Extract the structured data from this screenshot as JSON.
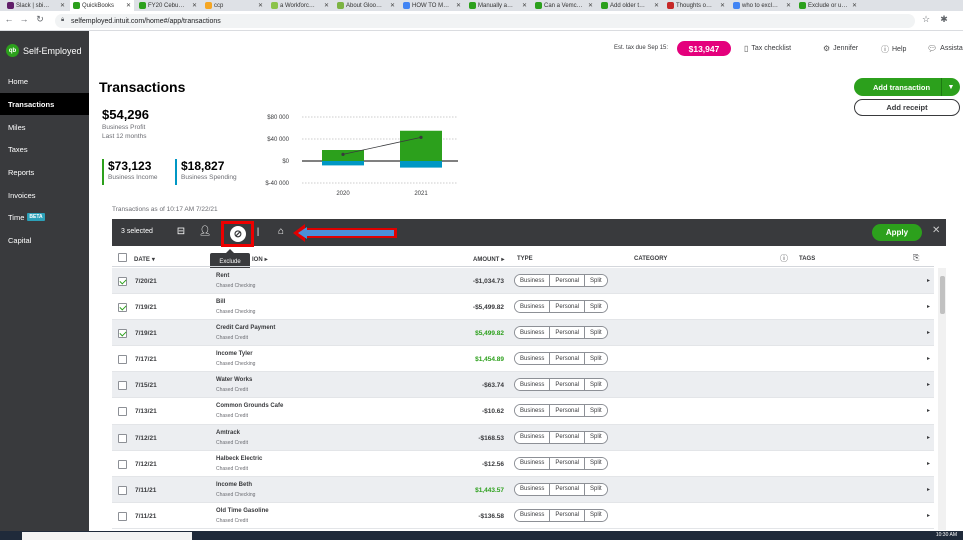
{
  "browser": {
    "tabs": [
      {
        "label": "Slack | sbi…",
        "color": "#611f69"
      },
      {
        "label": "QuickBooks",
        "color": "#2ca01c",
        "active": true
      },
      {
        "label": "FY20 Cebu…",
        "color": "#2ca01c"
      },
      {
        "label": "ccp",
        "color": "#f5a623"
      },
      {
        "label": "a Workforc…",
        "color": "#8bc34a"
      },
      {
        "label": "About Gloo…",
        "color": "#7cb342"
      },
      {
        "label": "HOW TO M…",
        "color": "#4285f4"
      },
      {
        "label": "Manually a…",
        "color": "#2ca01c"
      },
      {
        "label": "Can a Vemc…",
        "color": "#2ca01c"
      },
      {
        "label": "Add older t…",
        "color": "#2ca01c"
      },
      {
        "label": "Thoughts o…",
        "color": "#c62828"
      },
      {
        "label": "who to excl…",
        "color": "#4285f4"
      },
      {
        "label": "Exclude or u…",
        "color": "#2ca01c"
      }
    ],
    "url": "selfemployed.intuit.com/home#/app/transactions"
  },
  "app": {
    "logo_badge": "qb",
    "logo_text": "Self-Employed"
  },
  "sidebar": {
    "items": [
      {
        "label": "Home"
      },
      {
        "label": "Transactions",
        "active": true
      },
      {
        "label": "Miles"
      },
      {
        "label": "Taxes"
      },
      {
        "label": "Reports"
      },
      {
        "label": "Invoices"
      },
      {
        "label": "Time",
        "badge": "BETA"
      },
      {
        "label": "Capital"
      }
    ]
  },
  "topbar": {
    "est_tax_label": "Est. tax due Sep 15:",
    "est_tax_value": "$13,947",
    "tax_checklist": "Tax checklist",
    "user": "Jennifer",
    "help": "Help",
    "assistant": "Assista"
  },
  "page": {
    "title": "Transactions",
    "profit_value": "$54,296",
    "profit_label": "Business Profit",
    "period": "Last 12 months",
    "income_value": "$73,123",
    "income_label": "Business Income",
    "spending_value": "$18,827",
    "spending_label": "Business Spending",
    "add_transaction": "Add transaction",
    "add_receipt": "Add receipt",
    "as_of": "Transactions as of 10:17 AM 7/22/21",
    "colors": {
      "green": "#2ca01c",
      "blue": "#0097c4",
      "pink": "#e4007c",
      "highlight": "#e00000",
      "arrow": "#4a90d9"
    }
  },
  "chart_data": {
    "type": "bar",
    "categories": [
      "2020",
      "2021"
    ],
    "series": [
      {
        "values": [
          20000,
          55000
        ]
      },
      {
        "values": [
          -8000,
          -12000
        ]
      },
      {
        "values": [
          12000,
          43000
        ]
      }
    ],
    "ytick_labels": [
      "$80 000",
      "$40 000",
      "$0",
      "$-40 000"
    ],
    "yticks": [
      80000,
      40000,
      0,
      -40000
    ],
    "ylim": [
      -40000,
      80000
    ],
    "grid": true
  },
  "bulk": {
    "selected": "3 selected",
    "apply": "Apply",
    "tooltip": "Exclude"
  },
  "table": {
    "headers": {
      "date": "DATE",
      "description": "ION",
      "amount": "AMOUNT",
      "type": "TYPE",
      "category": "CATEGORY",
      "tags": "TAGS"
    },
    "segments": [
      "Business",
      "Personal",
      "Split"
    ],
    "rows": [
      {
        "checked": true,
        "date": "7/20/21",
        "desc": "Rent",
        "account": "Chased Checking",
        "amount": "-$1,034.73",
        "pos": false
      },
      {
        "checked": true,
        "date": "7/19/21",
        "desc": "Bill",
        "account": "Chased Checking",
        "amount": "-$5,499.82",
        "pos": false
      },
      {
        "checked": true,
        "date": "7/19/21",
        "desc": "Credit Card Payment",
        "account": "Chased Credit",
        "amount": "$5,499.82",
        "pos": true
      },
      {
        "checked": false,
        "date": "7/17/21",
        "desc": "Income Tyler",
        "account": "Chased Checking",
        "amount": "$1,454.89",
        "pos": true
      },
      {
        "checked": false,
        "date": "7/15/21",
        "desc": "Water Works",
        "account": "Chased Credit",
        "amount": "-$63.74",
        "pos": false
      },
      {
        "checked": false,
        "date": "7/13/21",
        "desc": "Common Grounds Cafe",
        "account": "Chased Credit",
        "amount": "-$10.62",
        "pos": false
      },
      {
        "checked": false,
        "date": "7/12/21",
        "desc": "Amtrack",
        "account": "Chased Credit",
        "amount": "-$168.53",
        "pos": false
      },
      {
        "checked": false,
        "date": "7/12/21",
        "desc": "Halbeck Electric",
        "account": "Chased Credit",
        "amount": "-$12.56",
        "pos": false
      },
      {
        "checked": false,
        "date": "7/11/21",
        "desc": "Income Beth",
        "account": "Chased Checking",
        "amount": "$1,443.57",
        "pos": true
      },
      {
        "checked": false,
        "date": "7/11/21",
        "desc": "Old Time Gasoline",
        "account": "Chased Credit",
        "amount": "-$136.58",
        "pos": false
      }
    ]
  },
  "taskbar": {
    "clock": "10:30 AM"
  }
}
